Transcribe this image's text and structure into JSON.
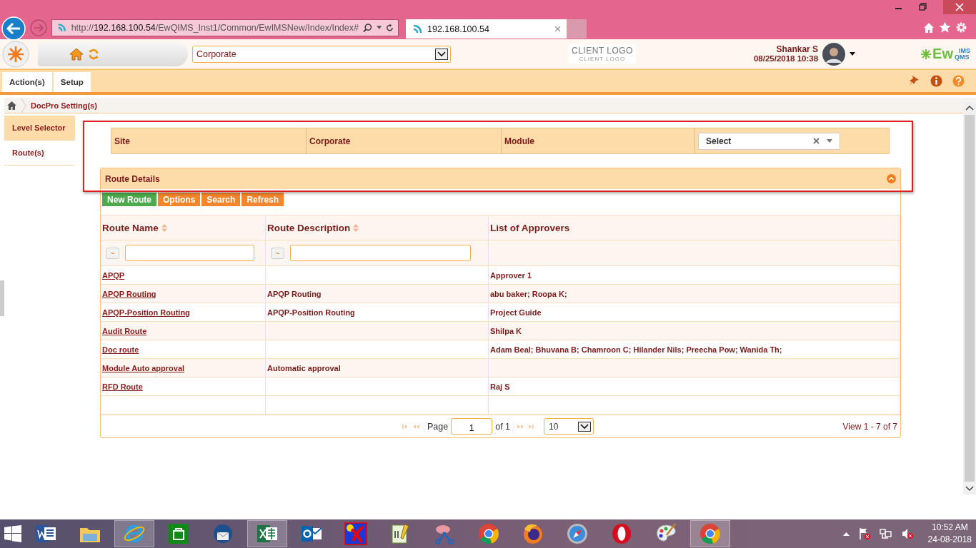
{
  "browser": {
    "url_scheme": "http://",
    "url_host": "192.168.100.54",
    "url_path": "/EwQIMS_Inst1/Common/EwIMSNew/Index/Index#",
    "tab_title": "192.168.100.54"
  },
  "header": {
    "site_select": "Corporate",
    "client_logo": "CLIENT LOGO",
    "client_logo_sub": "CLIENT LOGO",
    "user_name": "Shankar S",
    "datetime": "08/25/2018 10:38",
    "brand": "Ew",
    "brand_top": "IMS",
    "brand_bottom": "QMS"
  },
  "menu": [
    {
      "label": "Action(s)"
    },
    {
      "label": "Setup"
    }
  ],
  "breadcrumb": "DocPro Setting(s)",
  "sidebar": [
    {
      "label": "Level Selector",
      "selected": true
    },
    {
      "label": "Route(s)",
      "selected": false
    }
  ],
  "level_filter": {
    "site_label": "Site",
    "site_value": "Corporate",
    "module_label": "Module",
    "module_placeholder": "Select"
  },
  "panel": {
    "title": "Route Details",
    "buttons": [
      {
        "label": "New Route",
        "kind": "primary"
      },
      {
        "label": "Options",
        "kind": "secondary"
      },
      {
        "label": "Search",
        "kind": "secondary"
      },
      {
        "label": "Refresh",
        "kind": "secondary"
      }
    ],
    "columns": [
      {
        "label": "Route Name",
        "sortable": true,
        "filter_op": "~"
      },
      {
        "label": "Route Description",
        "sortable": true,
        "filter_op": "~"
      },
      {
        "label": "List of Approvers",
        "sortable": false
      }
    ],
    "rows": [
      {
        "name": "APQP ",
        "description": "",
        "approvers": "Approver 1"
      },
      {
        "name": "APQP Routing",
        "description": "APQP Routing",
        "approvers": "abu baker; Roopa K;"
      },
      {
        "name": "APQP-Position Routing",
        "description": "APQP-Position Routing",
        "approvers": "Project Guide"
      },
      {
        "name": "Audit Route",
        "description": "",
        "approvers": "Shilpa K"
      },
      {
        "name": "Doc route",
        "description": "",
        "approvers": "Adam Beal; Bhuvana  B; Chamroon C; Hilander Nils; Preecha Pow; Wanida  Th;"
      },
      {
        "name": "Module Auto approval",
        "description": "Automatic approval",
        "approvers": ""
      },
      {
        "name": "RFD Route",
        "description": "",
        "approvers": "Raj S"
      }
    ],
    "pager": {
      "page_label": "Page",
      "page": "1",
      "of": "of 1",
      "page_size": "10",
      "view": "View 1 - 7 of 7"
    }
  },
  "taskbar": {
    "apps": [
      {
        "active": false
      },
      {
        "active": false
      },
      {
        "active": true
      },
      {
        "active": false
      },
      {
        "active": false
      },
      {
        "active": true
      },
      {
        "active": false
      },
      {
        "active": false
      },
      {
        "active": false
      },
      {
        "active": false
      },
      {
        "active": false
      },
      {
        "active": false
      },
      {
        "active": false
      },
      {
        "active": false
      },
      {
        "active": false
      },
      {
        "active": true
      }
    ],
    "time": "10:52 AM",
    "date": "24-08-2018"
  }
}
